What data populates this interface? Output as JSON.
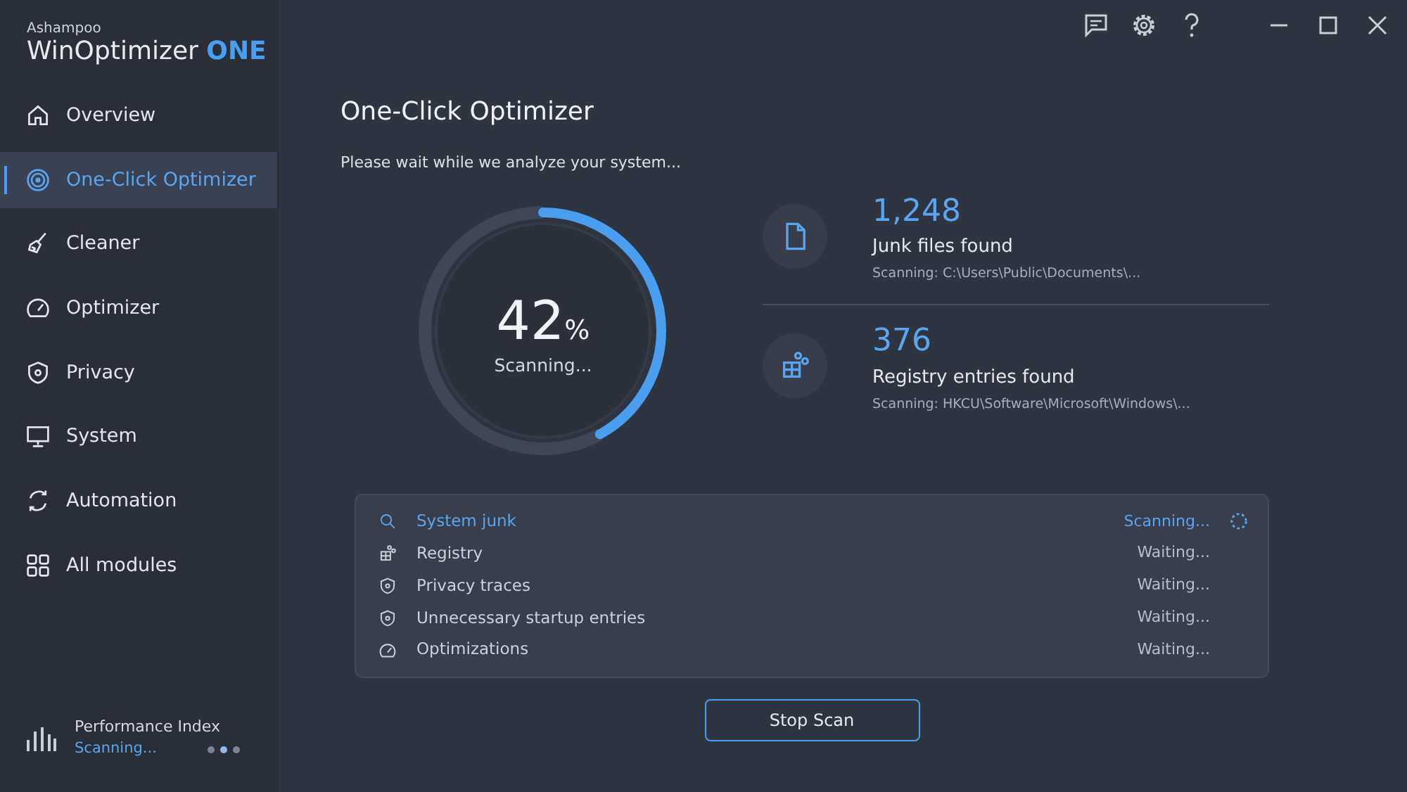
{
  "app": {
    "brand": "Ashampoo",
    "name": "WinOptimizer",
    "edition": "ONE"
  },
  "sidebar": {
    "items": [
      {
        "label": "Overview",
        "kind": "home",
        "selected": false
      },
      {
        "label": "One-Click Optimizer",
        "kind": "target",
        "selected": true
      },
      {
        "label": "Cleaner",
        "kind": "broom",
        "selected": false
      },
      {
        "label": "Optimizer",
        "kind": "gauge",
        "selected": false
      },
      {
        "label": "Privacy",
        "kind": "shield",
        "selected": false
      },
      {
        "label": "System",
        "kind": "monitor",
        "selected": false
      },
      {
        "label": "Automation",
        "kind": "cycle",
        "selected": false
      },
      {
        "label": "All modules",
        "kind": "grid",
        "selected": false
      }
    ],
    "performance": {
      "title": "Performance Index",
      "status": "Scanning..."
    }
  },
  "page": {
    "title": "One-Click Optimizer",
    "subtitle": "Please wait while we analyze your system...",
    "progress": {
      "value": "42",
      "unit": "%",
      "status": "Scanning...",
      "level": 0.42
    },
    "stats": [
      {
        "kind": "file",
        "count": "1,248",
        "label": "Junk files found",
        "detail": "Scanning: C:\\Users\\Public\\Documents\\..."
      },
      {
        "kind": "cubes",
        "count": "376",
        "label": "Registry entries found",
        "detail": "Scanning: HKCU\\Software\\Microsoft\\Windows\\..."
      }
    ],
    "tasks": [
      {
        "kind": "search",
        "label": "System junk",
        "status": "Scanning...",
        "active": true
      },
      {
        "kind": "cubes",
        "label": "Registry",
        "status": "Waiting...",
        "active": false
      },
      {
        "kind": "shield",
        "label": "Privacy traces",
        "status": "Waiting...",
        "active": false
      },
      {
        "kind": "shield",
        "label": "Unnecessary startup entries",
        "status": "Waiting...",
        "active": false
      },
      {
        "kind": "gauge",
        "label": "Optimizations",
        "status": "Waiting...",
        "active": false
      }
    ],
    "stop_button": "Stop Scan"
  }
}
